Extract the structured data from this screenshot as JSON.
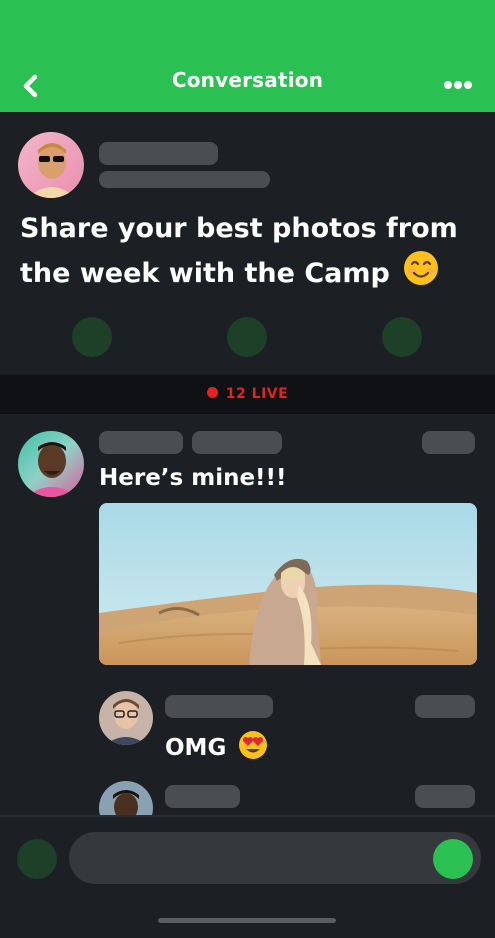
{
  "header": {
    "title": "Conversation",
    "back_icon": "chevron-left-icon",
    "more_icon": "more-horizontal-icon",
    "color": "#2bc152"
  },
  "post": {
    "text": "Share your best photos from the week with the Camp",
    "emoji": "smiling-face-emoji"
  },
  "live": {
    "label": "12 LIVE",
    "color": "#e02424"
  },
  "messages": [
    {
      "text": "Here’s mine!!!",
      "has_photo": true,
      "photo": "desert-woman-photo"
    },
    {
      "text": "OMG",
      "emoji": "heart-eyes-emoji"
    },
    {
      "text": ""
    }
  ],
  "composer": {
    "camera_icon": "camera-button",
    "send_icon": "send-button"
  }
}
